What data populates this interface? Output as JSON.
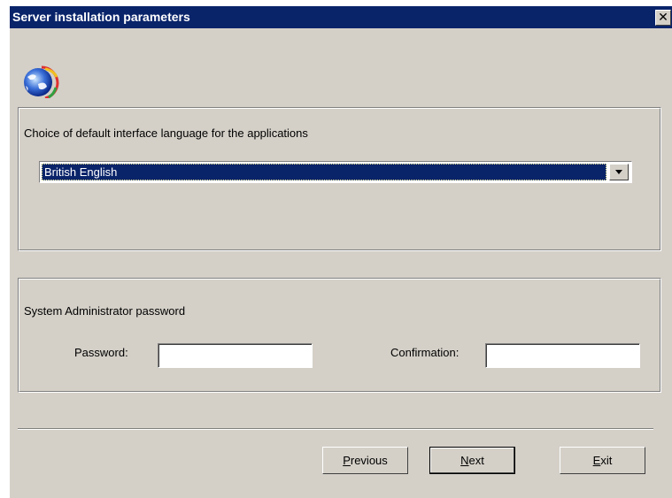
{
  "window": {
    "title": "Server installation parameters",
    "close_glyph": "✕"
  },
  "language_group": {
    "label": "Choice of default interface language for the applications",
    "selected": "British English"
  },
  "password_group": {
    "label": "System Administrator password",
    "password_label": "Password:",
    "password_value": "",
    "confirmation_label": "Confirmation:",
    "confirmation_value": ""
  },
  "buttons": {
    "previous": {
      "accel": "P",
      "rest": "revious"
    },
    "next": {
      "accel": "N",
      "rest": "ext"
    },
    "exit": {
      "accel": "E",
      "rest": "xit"
    }
  },
  "colors": {
    "titlebar": "#0a246a",
    "dialog_bg": "#d4d0c8",
    "selection": "#0a246a"
  },
  "icons": {
    "app_logo": "globe-icon"
  }
}
